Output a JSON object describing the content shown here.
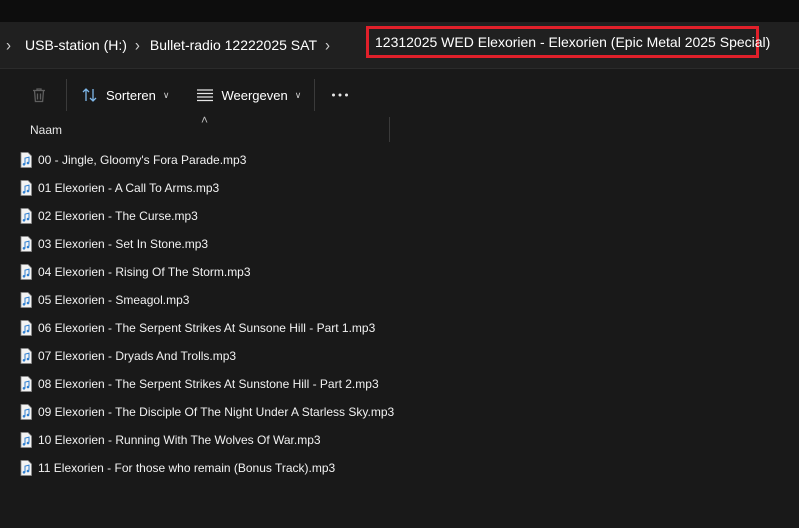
{
  "breadcrumb": {
    "items": [
      "USB-station (H:)",
      "Bullet-radio 12222025 SAT"
    ],
    "current": "12312025 WED Elexorien - Elexorien (Epic Metal 2025 Special)"
  },
  "toolbar": {
    "sort_label": "Sorteren",
    "view_label": "Weergeven"
  },
  "columns": {
    "name_header": "Naam"
  },
  "files": [
    "00 - Jingle, Gloomy's Fora Parade.mp3",
    "01 Elexorien - A Call To Arms.mp3",
    "02 Elexorien - The Curse.mp3",
    "03 Elexorien - Set In Stone.mp3",
    "04 Elexorien - Rising Of The Storm.mp3",
    "05 Elexorien - Smeagol.mp3",
    "06 Elexorien - The Serpent Strikes At Sunsone Hill - Part 1.mp3",
    "07 Elexorien - Dryads And Trolls.mp3",
    "08 Elexorien - The Serpent Strikes At Sunstone Hill - Part 2.mp3",
    "09 Elexorien - The Disciple Of The Night Under A Starless Sky.mp3",
    "10 Elexorien - Running With The Wolves Of War.mp3",
    "11 Elexorien - For those who remain (Bonus Track).mp3"
  ],
  "colors": {
    "highlight": "#e0202a",
    "background": "#191919",
    "file_icon_accent": "#4aa3e8"
  },
  "icons": {
    "breadcrumb_separator": "chevron-right-icon",
    "delete": "trash-icon",
    "sort": "sort-icon",
    "view": "view-icon",
    "more": "more-icon",
    "file": "audio-file-icon"
  }
}
